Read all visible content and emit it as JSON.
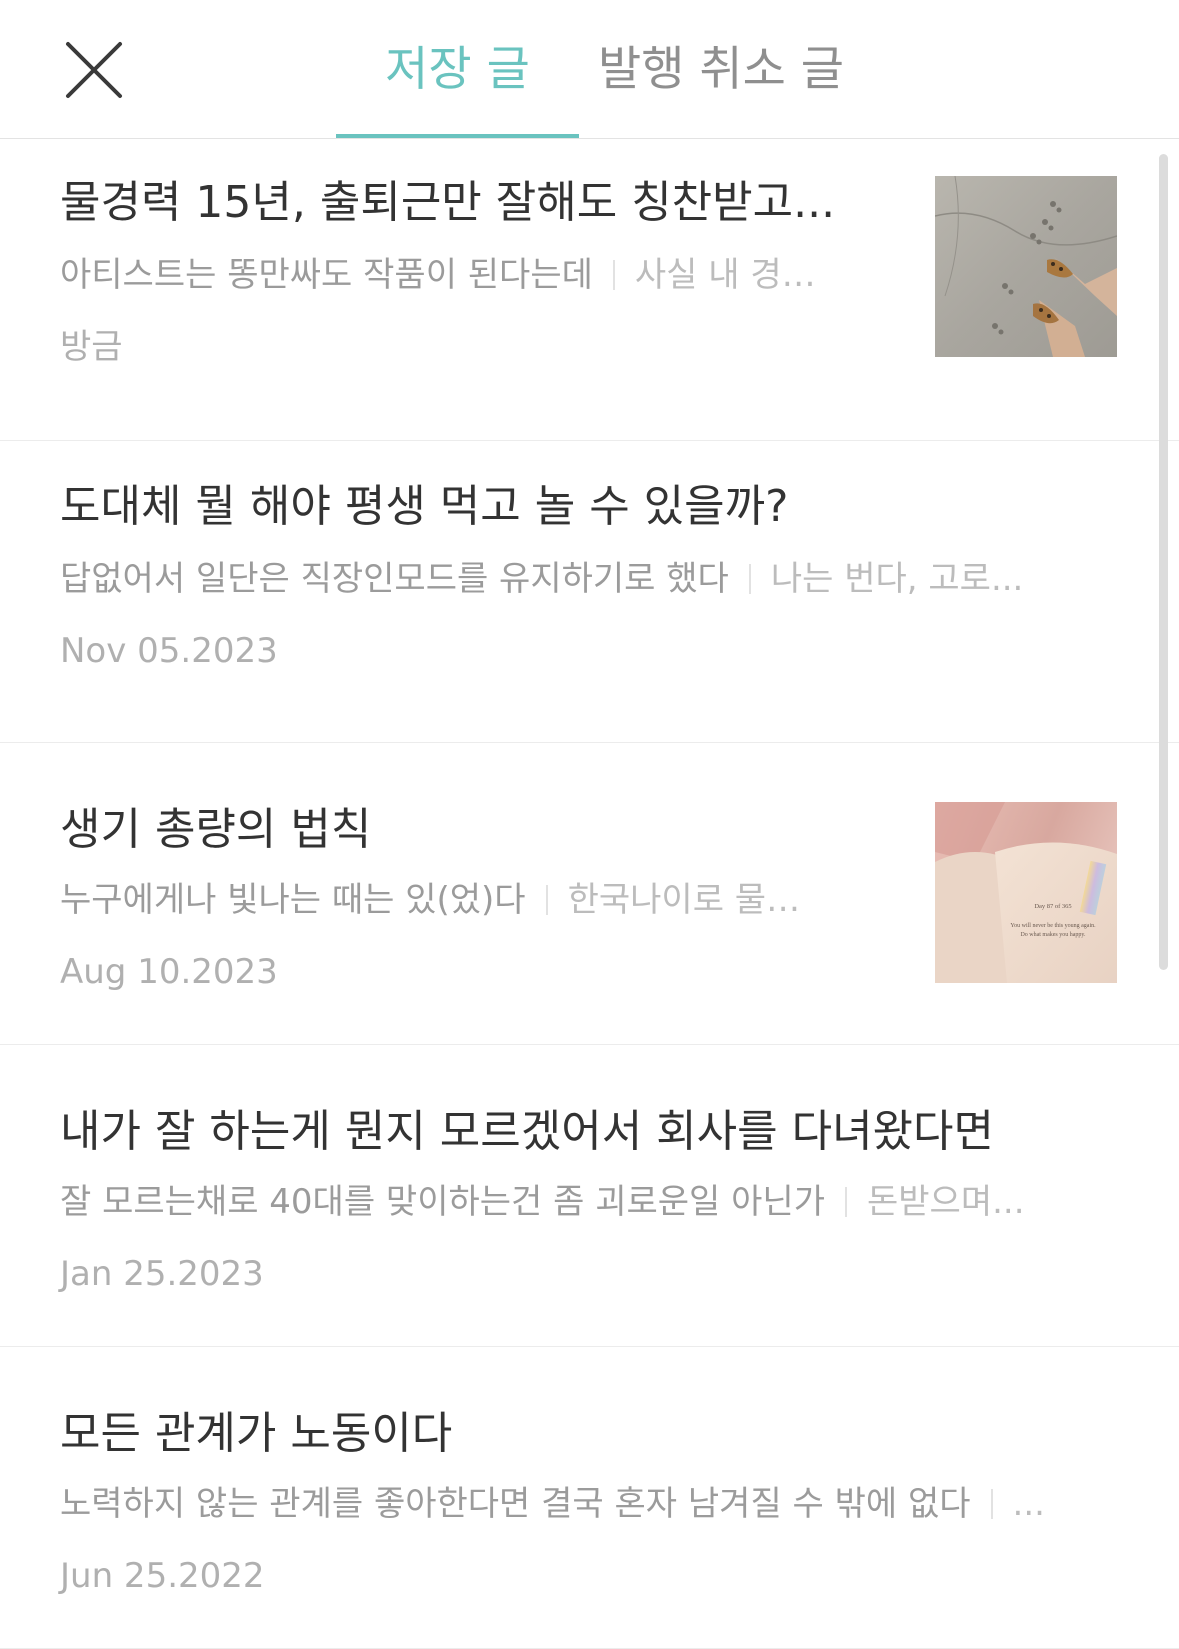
{
  "header": {
    "close_icon": "close-icon",
    "tabs": [
      {
        "label": "저장 글",
        "active": true
      },
      {
        "label": "발행 취소 글",
        "active": false
      }
    ],
    "accent_color": "#6ac3bf"
  },
  "posts": [
    {
      "title": "물경력 15년, 출퇴근만 잘해도 칭찬받고...",
      "subtitle": "아티스트는 똥만싸도 작품이 된다는데",
      "excerpt": "사실 내 경…",
      "date": "방금",
      "thumbnail": "photo-feet-on-pavement"
    },
    {
      "title": "도대체 뭘 해야 평생 먹고 놀 수 있을까?",
      "subtitle": "답없어서 일단은 직장인모드를 유지하기로 했다",
      "excerpt": "나는 번다, 고로...",
      "date": "Nov 05.2023"
    },
    {
      "title": "생기 총량의 법칙",
      "subtitle": "누구에게나 빛나는 때는 있(었)다",
      "excerpt": "한국나이로 물…",
      "date": "Aug 10.2023",
      "thumbnail": "photo-open-book",
      "thumbnail_text": {
        "line1": "Day 87 of 365",
        "line2": "You will never be this young again.",
        "line3": "Do what makes you happy."
      }
    },
    {
      "title": "내가 잘 하는게 뭔지 모르겠어서 회사를 다녀왔다면",
      "subtitle": "잘 모르는채로 40대를 맞이하는건 좀 괴로운일 아닌가",
      "excerpt": "돈받으며...",
      "date": "Jan 25.2023"
    },
    {
      "title": "모든 관계가 노동이다",
      "subtitle": "노력하지 않는 관계를 좋아한다면 결국 혼자 남겨질 수 밖에 없다",
      "excerpt": "...",
      "date": "Jun 25.2022"
    }
  ]
}
